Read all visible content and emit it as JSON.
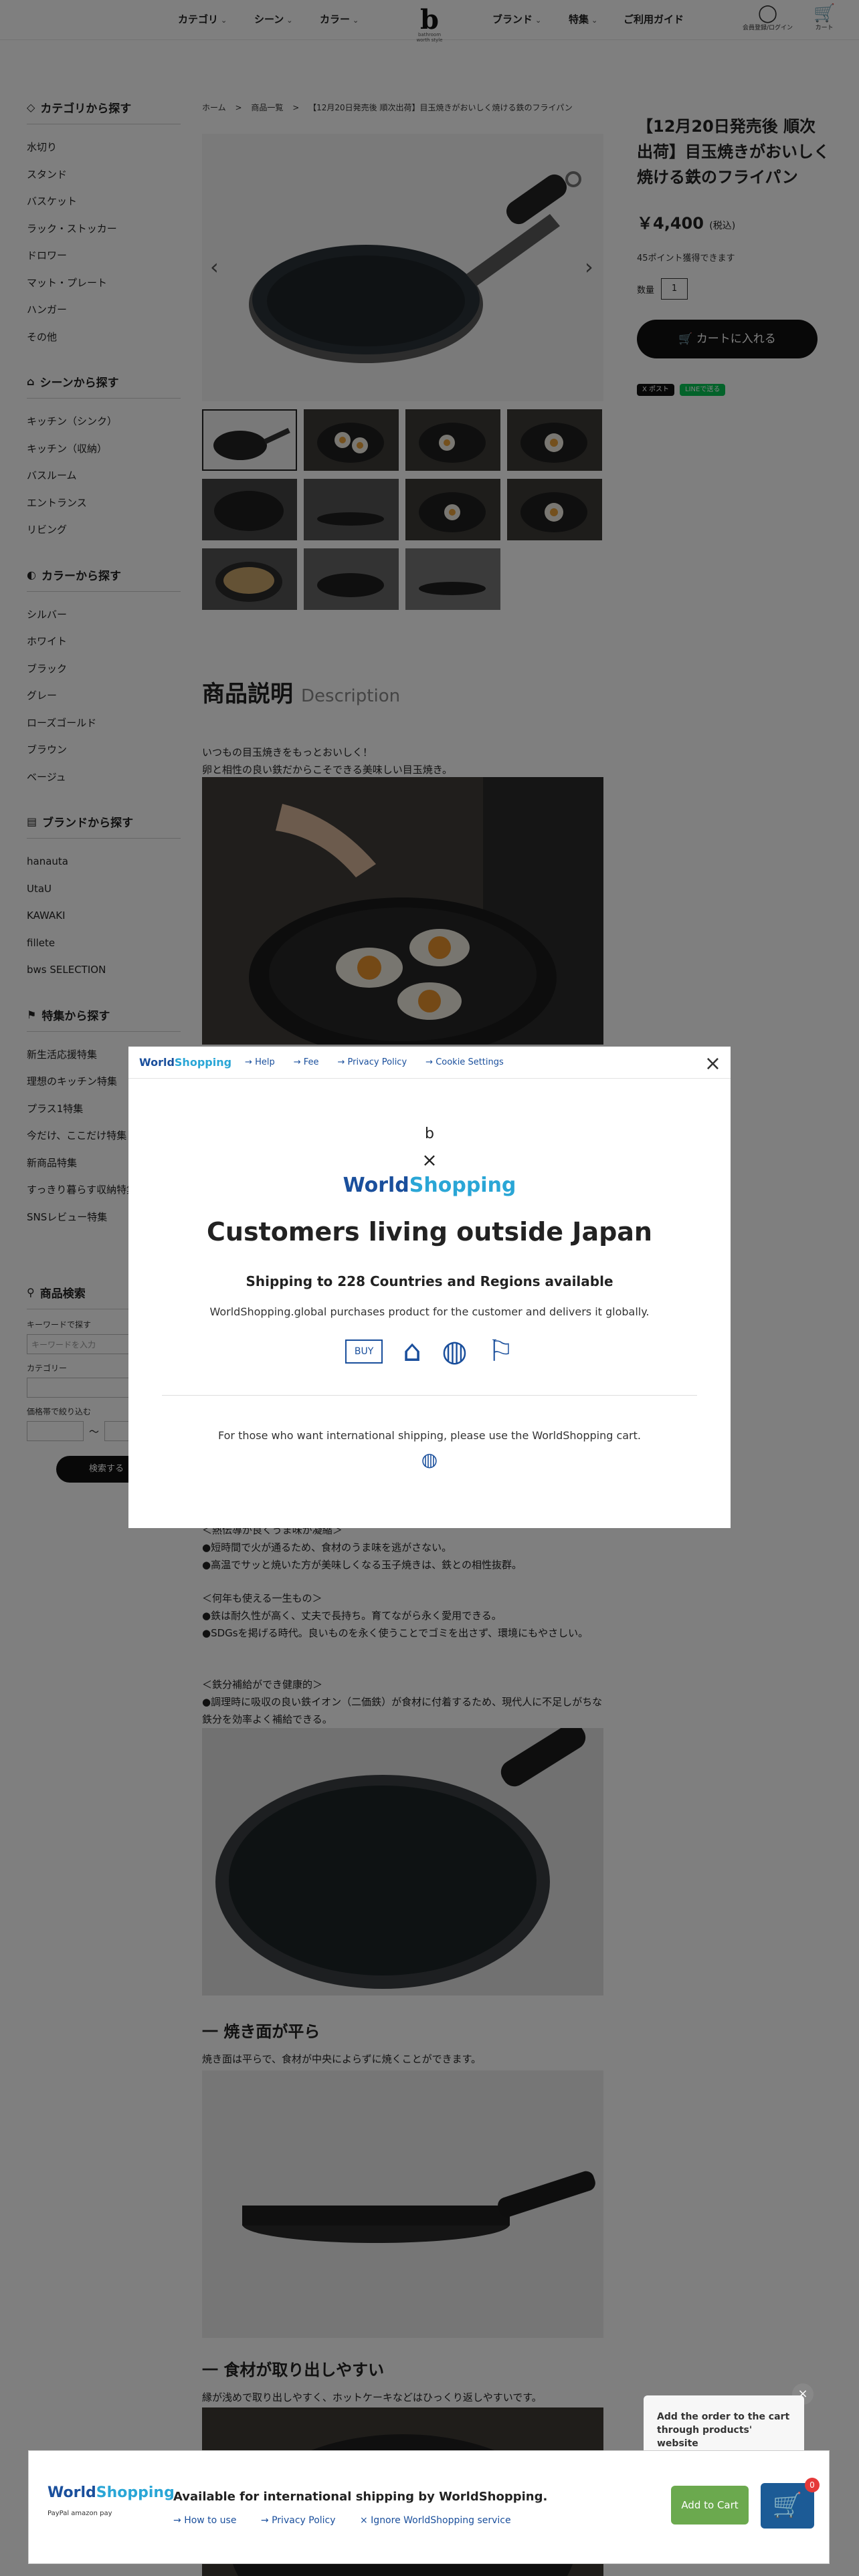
{
  "header": {
    "nav_left": [
      "カテゴリ",
      "シーン",
      "カラー"
    ],
    "nav_right": [
      "ブランド",
      "特集",
      "ご利用ガイド"
    ],
    "logo_text": "bathroom worth style",
    "login_label": "会員登録/ログイン",
    "cart_label": "カート"
  },
  "sidebar": {
    "category": {
      "title": "カテゴリから探す",
      "items": [
        "水切り",
        "スタンド",
        "バスケット",
        "ラック・ストッカー",
        "ドロワー",
        "マット・プレート",
        "ハンガー",
        "その他"
      ]
    },
    "scene": {
      "title": "シーンから探す",
      "items": [
        "キッチン（シンク）",
        "キッチン（収納）",
        "バスルーム",
        "エントランス",
        "リビング"
      ]
    },
    "color": {
      "title": "カラーから探す",
      "items": [
        "シルバー",
        "ホワイト",
        "ブラック",
        "グレー",
        "ローズゴールド",
        "ブラウン",
        "ベージュ"
      ]
    },
    "brand": {
      "title": "ブランドから探す",
      "items": [
        "hanauta",
        "UtaU",
        "KAWAKI",
        "fillete",
        "bws SELECTION"
      ]
    },
    "feature": {
      "title": "特集から探す",
      "items": [
        "新生活応援特集",
        "理想のキッチン特集",
        "プラス1特集",
        "今だけ、ここだけ特集",
        "新商品特集",
        "すっきり暮らす収納特集",
        "SNSレビュー特集"
      ]
    }
  },
  "search": {
    "title": "商品検索",
    "keyword_label": "キーワードで探す",
    "keyword_placeholder": "キーワードを入力",
    "category_label": "カテゴリー",
    "price_label": "価格帯で絞り込む",
    "range_sep": "〜",
    "button": "検索する"
  },
  "breadcrumb": [
    "ホーム",
    ">",
    "商品一覧",
    ">",
    "【12月20日発売後 順次出荷】目玉焼きがおいしく焼ける鉄のフライパン"
  ],
  "product": {
    "title": "【12月20日発売後 順次出荷】目玉焼きがおいしく焼ける鉄のフライパン",
    "price": "￥4,400",
    "price_note": "(税込)",
    "points": "45ポイント獲得できます",
    "qty_label": "数量",
    "qty_value": "1",
    "cart_button": "カートに入れる",
    "share": [
      "X ポスト",
      "LINEで送る"
    ]
  },
  "description": {
    "title": "商品説明",
    "title_en": "Description",
    "lead": [
      "いつもの目玉焼きをもっとおいしく！",
      "卵と相性の良い鉄だからこそできる美味しい目玉焼き。"
    ],
    "blocks": [
      [
        "＜熱伝導が良くうま味が凝縮＞",
        "●短時間で火が通るため、食材のうま味を逃がさない。",
        "●高温でサッと焼いた方が美味しくなる玉子焼きは、鉄との相性抜群。"
      ],
      [
        "＜何年も使える一生もの＞",
        "●鉄は耐久性が高く、丈夫で長持ち。育てながら永く愛用できる。",
        "●SDGsを掲げる時代。良いものを永く使うことでゴミを出さず、環境にもやさしい。"
      ],
      [
        "＜鉄分補給ができ健康的＞",
        "●調理時に吸収の良い鉄イオン（二価鉄）が食材に付着するため、現代人に不足しがちな鉄分を効率よく補給できる。"
      ]
    ],
    "h_flat": "一 焼き面が平ら",
    "flat_text": "焼き面は平らで、食材が中央によらずに焼くことができます。",
    "h_easy": "一 食材が取り出しやすい",
    "easy_text": "縁が浅めで取り出しやすく、ホットケーキなどはひっくり返しやすいです。"
  },
  "modal": {
    "logo_a": "World",
    "logo_b": "Shopping",
    "links": [
      "Help",
      "Fee",
      "Privacy Policy",
      "Cookie Settings"
    ],
    "headline": "Customers living outside Japan",
    "shipping": "Shipping to 228 Countries and Regions available",
    "desc": "WorldShopping.global purchases product for the customer and delivers it globally.",
    "step_buy": "BUY",
    "footer": "For those who want international shipping, please use the WorldShopping cart."
  },
  "bottom_bar": {
    "title": "Available for international shipping by WorldShopping.",
    "links": [
      "How to use",
      "Privacy Policy",
      "Ignore WorldShopping service"
    ],
    "payments": "PayPal  amazon pay",
    "add_to_cart": "Add to Cart",
    "badge": "0",
    "tooltip": "Add the order to the cart through products' website"
  },
  "colors": {
    "accent": "#1a4f9c",
    "accent_light": "#2aa6d6",
    "dark": "#111111",
    "green": "#6ba94e"
  }
}
